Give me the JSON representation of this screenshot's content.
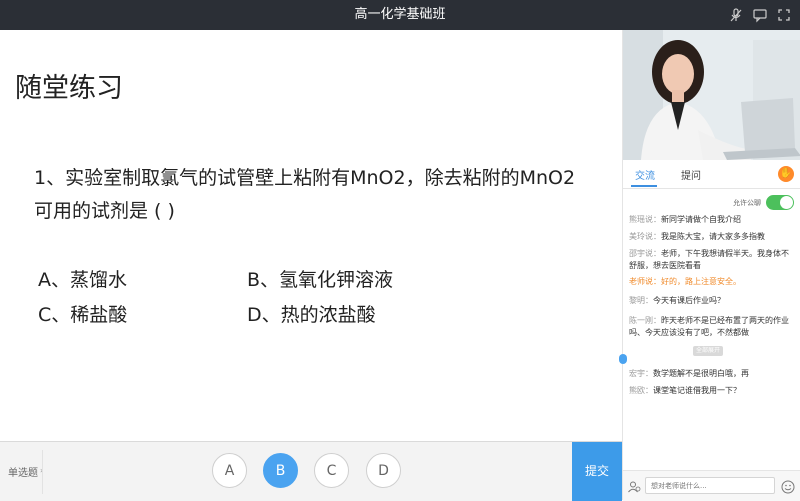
{
  "window": {
    "title": "高一化学基础班"
  },
  "slide": {
    "heading": "随堂练习",
    "question_line1": "1、实验室制取氯气的试管壁上粘附有MnO2，除去粘附的MnO2",
    "question_line2": "可用的试剂是 (          )",
    "options": {
      "a": "A、蒸馏水",
      "b": "B、氢氧化钾溶液",
      "c": "C、稀盐酸",
      "d": "D、热的浓盐酸"
    }
  },
  "answer_bar": {
    "question_type": "单选题",
    "choices": [
      "A",
      "B",
      "C",
      "D"
    ],
    "selected": "B",
    "submit_label": "提交"
  },
  "panel": {
    "tabs": {
      "chat": "交流",
      "question": "提问"
    },
    "allow_private_chat": "允许公聊",
    "messages": [
      {
        "who": "熊瑶说：",
        "text": "新同学请做个自我介绍"
      },
      {
        "who": "美玲说：",
        "text": "我是陈大宝，请大家多多指教"
      },
      {
        "who": "邵宇说：",
        "text": "老师，下午我想请假半天。我身体不舒服，想去医院看看"
      },
      {
        "who": "老师说：",
        "text": "好的，路上注意安全。"
      },
      {
        "who": "黎明：",
        "text": "今天有课后作业吗？"
      },
      {
        "who": "陈一刚：",
        "text": "昨天老师不是已经布置了两天的作业吗、今天应该没有了吧，不然都做"
      },
      {
        "who": "宏宇：",
        "text": "数学题解不是很明白哦，再"
      },
      {
        "who": "熊欧：",
        "text": "课堂笔记谁借我用一下？"
      }
    ],
    "expand_label": "全部展开",
    "input_placeholder": "想对老师说什么..."
  },
  "colors": {
    "accent": "#3d9be9",
    "teacher_text": "#f08a2a",
    "toggle_on": "#4cc05c",
    "hand": "#ff8a2a"
  }
}
